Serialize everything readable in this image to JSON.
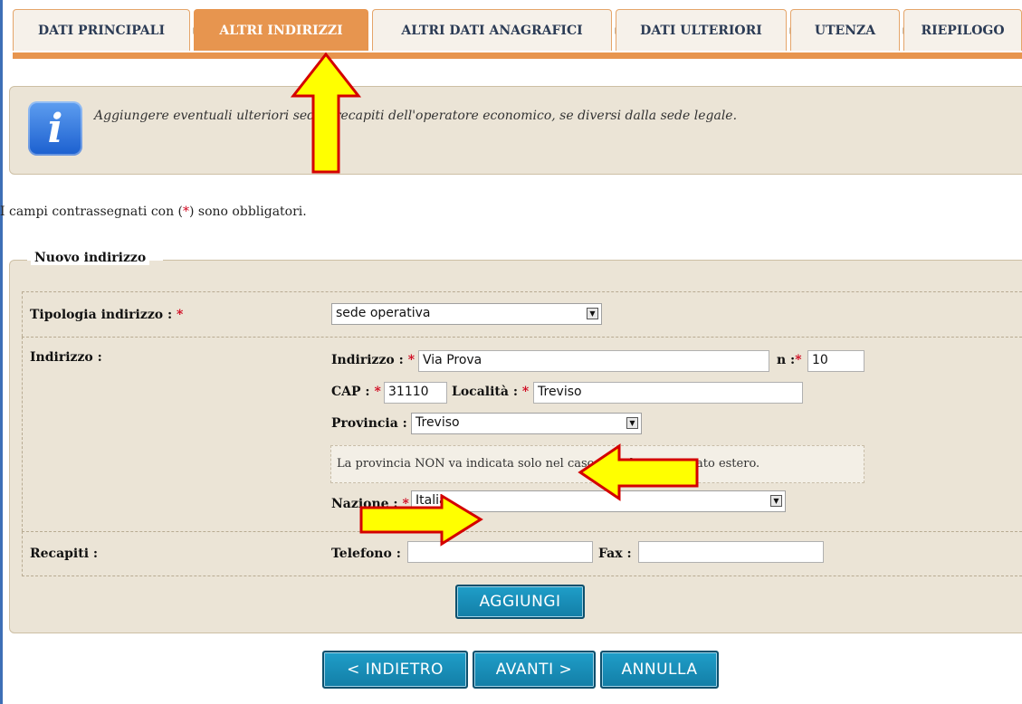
{
  "tabs": [
    {
      "label": "DATI PRINCIPALI"
    },
    {
      "label": "ALTRI INDIRIZZI",
      "active": true
    },
    {
      "label": "ALTRI DATI ANAGRAFICI"
    },
    {
      "label": "DATI ULTERIORI"
    },
    {
      "label": "UTENZA"
    },
    {
      "label": "RIEPILOGO"
    }
  ],
  "info": {
    "icon": "info-icon",
    "icon_glyph": "i",
    "text": "Aggiungere eventuali ulteriori sedi e recapiti dell'operatore economico, se diversi dalla sede legale."
  },
  "mandatory_note": {
    "before": "I campi contrassegnati con (",
    "star": "*",
    "after": ") sono obbligatori."
  },
  "fieldset": {
    "legend": "Nuovo indirizzo",
    "tipologia": {
      "label": "Tipologia indirizzo :",
      "value": "sede operativa"
    },
    "indirizzo_row": {
      "label": "Indirizzo :"
    },
    "indirizzo": {
      "label": "Indirizzo :",
      "value": "Via Prova"
    },
    "numero": {
      "label": "n :",
      "value": "10"
    },
    "cap": {
      "label": "CAP :",
      "value": "31110"
    },
    "localita": {
      "label": "Località :",
      "value": "Treviso"
    },
    "provincia": {
      "label": "Provincia :",
      "value": "Treviso"
    },
    "provincia_note": "La provincia NON va indicata solo nel caso di sede in uno stato estero.",
    "nazione": {
      "label": "Nazione :",
      "value": "Italia"
    },
    "recapiti_row": {
      "label": "Recapiti :"
    },
    "telefono": {
      "label": "Telefono :",
      "value": ""
    },
    "fax": {
      "label": "Fax :",
      "value": ""
    },
    "add_button": "AGGIUNGI",
    "star": "*"
  },
  "nav": {
    "back": "< INDIETRO",
    "next": "AVANTI >",
    "cancel": "ANNULLA"
  },
  "colors": {
    "accent": "#e7954f",
    "button": "#1784ad",
    "panel": "#ebe4d6",
    "highlight_arrow": "#ffff00"
  }
}
